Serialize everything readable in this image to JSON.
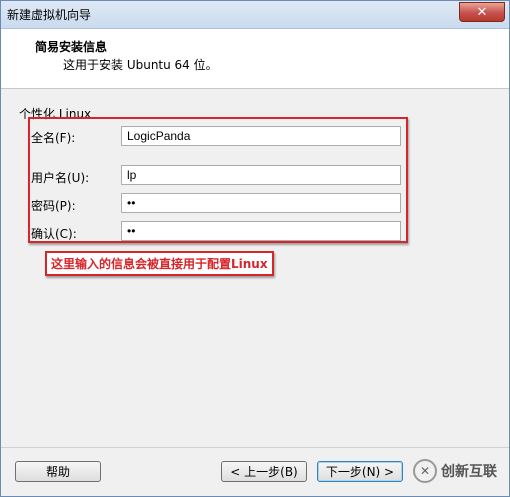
{
  "window": {
    "title": "新建虚拟机向导"
  },
  "header": {
    "title": "简易安装信息",
    "subtitle": "这用于安装 Ubuntu 64 位。"
  },
  "form": {
    "section_label": "个性化 Linux",
    "fullname": {
      "label": "全名(F):",
      "value": "LogicPanda"
    },
    "username": {
      "label": "用户名(U):",
      "value": "lp"
    },
    "password": {
      "label": "密码(P):",
      "value": "••"
    },
    "confirm": {
      "label": "确认(C):",
      "value": "••"
    }
  },
  "annotation": {
    "note": "这里输入的信息会被直接用于配置Linux",
    "color": "#d6252b"
  },
  "buttons": {
    "help": "帮助",
    "back": "< 上一步(B)",
    "next": "下一步(N) >"
  },
  "watermark": {
    "text": "创新互联",
    "logo_icon": "brand-logo-icon"
  }
}
